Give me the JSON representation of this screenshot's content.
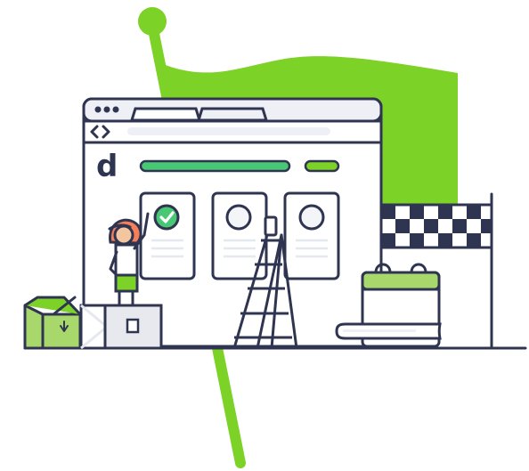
{
  "illustration": {
    "browser": {
      "logo_letter": "d",
      "nav_icon": "code-brackets-icon",
      "tab_count": 2,
      "window_control_count": 3
    },
    "cards": [
      {
        "name": "completed-card",
        "status_icon": "checkmark-icon",
        "state": "complete"
      },
      {
        "name": "pending-card-1",
        "status_icon": "empty-circle-icon",
        "state": "pending"
      },
      {
        "name": "pending-card-2",
        "status_icon": "empty-circle-icon",
        "state": "pending"
      }
    ],
    "progress_bar": {
      "primary_fill": 1,
      "secondary_fill": 1
    },
    "objects": {
      "flag": "green-flag",
      "finish": "checkered-finish-flag",
      "calendar": "calendar-icon",
      "ladder": "ladder",
      "worker": "worker-figure",
      "boxes": [
        "open-box",
        "closed-box",
        "crate"
      ]
    }
  },
  "colors": {
    "green": "#7CD226",
    "green_soft": "#A8D86B",
    "green_bar": "#48C774",
    "outline": "#2F3551",
    "ink": "#2F3551",
    "light": "#EEF0F6",
    "white": "#FFFFFF",
    "skin": "#F3C69F",
    "hat": "#F57F59",
    "box": "#E8E9EE"
  }
}
